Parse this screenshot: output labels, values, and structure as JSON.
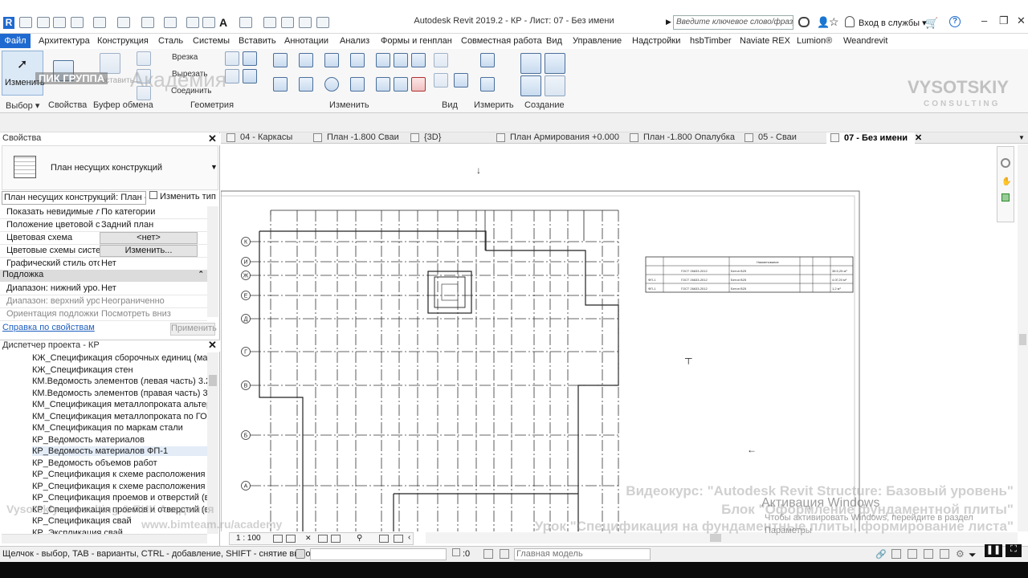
{
  "titlebar": {
    "title": "Autodesk Revit 2019.2 - КР - Лист: 07 - Без имени",
    "search_placeholder": "Введите ключевое слово/фразу",
    "sign_in": "Вход в службы"
  },
  "menu": {
    "file": "Файл",
    "tabs": [
      "Архитектура",
      "Конструкция",
      "Сталь",
      "Системы",
      "Вставить",
      "Аннотации",
      "Анализ",
      "Формы и генплан",
      "Совместная работа",
      "Вид",
      "Управление",
      "Надстройки",
      "hsbTimber",
      "Naviate REX",
      "Lumion®",
      "Weandrevit"
    ]
  },
  "ribbon": {
    "modify_label": "Изменить",
    "cut_label": "Вырезать",
    "join_label": "Соединить",
    "paste_label": "вставить",
    "vrezka_label": "Врезка",
    "panels": [
      "Выбор",
      "Свойства",
      "Буфер обмена",
      "Геометрия",
      "Изменить",
      "Вид",
      "Измерить",
      "Создание"
    ]
  },
  "properties": {
    "header": "Свойства",
    "type_name": "План несущих конструкций",
    "instance_select": "План несущих конструкций: План -",
    "edit_type": "Изменить тип",
    "rows": [
      {
        "k": "Показать невидимые л...",
        "v": "По категории"
      },
      {
        "k": "Положение цветовой с...",
        "v": "Задний план"
      },
      {
        "k": "Цветовая схема",
        "v": "<нет>"
      },
      {
        "k": "Цветовые схемы систе...",
        "v": "Изменить..."
      },
      {
        "k": "Графический стиль ото...",
        "v": "Нет"
      }
    ],
    "group": "Подложка",
    "rows2": [
      {
        "k": "Диапазон: нижний уро...",
        "v": "Нет"
      },
      {
        "k": "Диапазон: верхний уро...",
        "v": "Неограниченно"
      },
      {
        "k": "Ориентация подложки",
        "v": "Посмотреть вниз"
      }
    ],
    "help_link": "Справка по свойствам",
    "apply": "Применить"
  },
  "browser": {
    "header": "Диспетчер проекта - КР",
    "items": [
      "КЖ_Спецификация сборочных единиц (масса",
      "КЖ_Спецификация стен",
      "КМ.Ведомость элементов (левая часть) 3.2",
      "КМ.Ведомость элементов (правая часть) 3.1 (п",
      "КМ_Спецификация металлопроката альтернат",
      "КМ_Спецификация металлопроката по ГОСТ",
      "КМ_Спецификация по маркам стали",
      "КР_Ведомость материалов",
      "КР_Ведомость материалов ФП-1",
      "КР_Ведомость объемов работ",
      "КР_Спецификация к схеме расположения",
      "КР_Спецификация к схеме расположения фунд",
      "КР_Спецификация проемов и отверстий (высо",
      "КР_Спецификация проемов и отверстий (высо",
      "КР_Спецификация свай",
      "КР_Экспликация свай"
    ]
  },
  "view_tabs": [
    "04 - Каркасы",
    "План -1.800 Сваи",
    "{3D}",
    "План Армирования +0.000",
    "План -1.800 Опалубка",
    "05 - Сваи",
    "07 - Без имени"
  ],
  "drawing": {
    "grid_labels": [
      "К",
      "И",
      "Ж",
      "Е",
      "Д",
      "Г",
      "В",
      "Б",
      "А"
    ],
    "schedule_title": "Наименование",
    "schedule_rows": [
      {
        "c1": "",
        "c2": "ГОСТ 26633-2012",
        "c3": "Бетон В25",
        "c4": "38.5,25 м³"
      },
      {
        "c1": "ФП-1",
        "c2": "ГОСТ 26633-2012",
        "c3": "Бетон В25",
        "c4": "4.0Г,20 м³"
      },
      {
        "c1": "ФП-1",
        "c2": "ГОСТ 26633-2012",
        "c3": "Бетон В25",
        "c4": "1,2 м³"
      }
    ]
  },
  "view_control": {
    "scale": "1 : 100"
  },
  "statusbar": {
    "hint": "Щелчок - выбор, TAB - варианты, CTRL - добавление, SHIFT - снятие выбора.",
    "count": ":0",
    "model": "Главная модель"
  },
  "watermarks": {
    "pik_group": "ПИК ГРУППА",
    "academy": "Академия",
    "vysotskiy": "VYSOTSKIY",
    "consulting": "CONSULTING",
    "course": "Видеокурс: \"Autodesk Revit Structure: Базовый уровень\"",
    "block": "Блок \"Оформление фундаментной плиты\"",
    "lesson": "Урок \"Спецификация на фундаментные плиты, формирование листа\"",
    "left_brand": "Vysotskiy consulting & ПИК Академия",
    "url": "www.bimteam.ru/academy",
    "activation_title": "Активация Windows",
    "activation_text": "Чтобы активировать Windows, перейдите в раздел",
    "activation_params": "Параметры"
  }
}
